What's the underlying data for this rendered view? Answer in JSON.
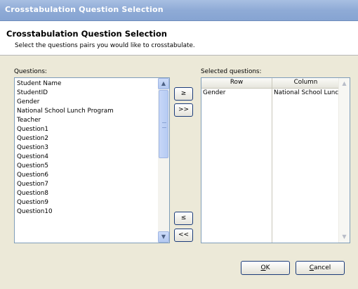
{
  "window": {
    "title": "Crosstabulation Question Selection"
  },
  "header": {
    "title": "Crosstabulation Question Selection",
    "subtitle": "Select the questions pairs you would like to crosstabulate."
  },
  "questions_panel": {
    "label": "Questions:",
    "items": [
      "Student Name",
      "StudentID",
      "Gender",
      "National School Lunch Program",
      "Teacher",
      "Question1",
      "Question2",
      "Question3",
      "Question4",
      "Question5",
      "Question6",
      "Question7",
      "Question8",
      "Question9",
      "Question10"
    ]
  },
  "move_buttons": {
    "add_one": "≥",
    "add_all": ">>",
    "remove_one": "≤",
    "remove_all": "<<"
  },
  "selected_panel": {
    "label": "Selected questions:",
    "columns": [
      "Row",
      "Column"
    ],
    "rows": [
      {
        "row": "Gender",
        "column": "National School Lunch"
      }
    ]
  },
  "footer": {
    "ok_rest": "K",
    "ok_key": "O",
    "cancel_rest": "ancel",
    "cancel_key": "C"
  }
}
